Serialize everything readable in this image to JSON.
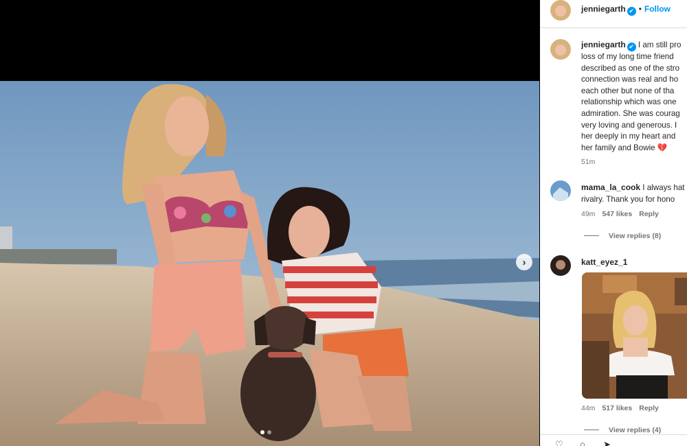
{
  "post": {
    "author": "jenniegarth",
    "verified_mark": "✔",
    "follow_label": "Follow",
    "separator": "•",
    "next_arrow": "›",
    "carousel_dots": 2,
    "carousel_active": 0
  },
  "caption": {
    "author": "jenniegarth",
    "lines": [
      "I am still pro",
      "loss of my long time friend",
      "described as one of the stro",
      "connection was real and ho",
      "each other but none of tha",
      "relationship which was one",
      "admiration. She was courag",
      "very loving and generous. I",
      "her deeply in my heart and",
      "her family and Bowie"
    ],
    "heart": "💔",
    "time": "51m"
  },
  "comments": [
    {
      "user": "mama_la_cook",
      "text_line1": "I always hat",
      "text_line2": "rivalry. Thank you for hono",
      "time": "49m",
      "likes": "547 likes",
      "reply_label": "Reply",
      "view_replies": "View replies (8)"
    },
    {
      "user": "katt_eyez_1",
      "time": "44m",
      "likes": "517 likes",
      "reply_label": "Reply",
      "view_replies": "View replies (4)"
    }
  ],
  "colors": {
    "accent": "#0095f6",
    "muted": "#737373",
    "heart": "#e0245e"
  },
  "icons": [
    "verified-badge-icon",
    "chevron-right-icon",
    "heart-icon",
    "comment-icon",
    "share-icon"
  ]
}
